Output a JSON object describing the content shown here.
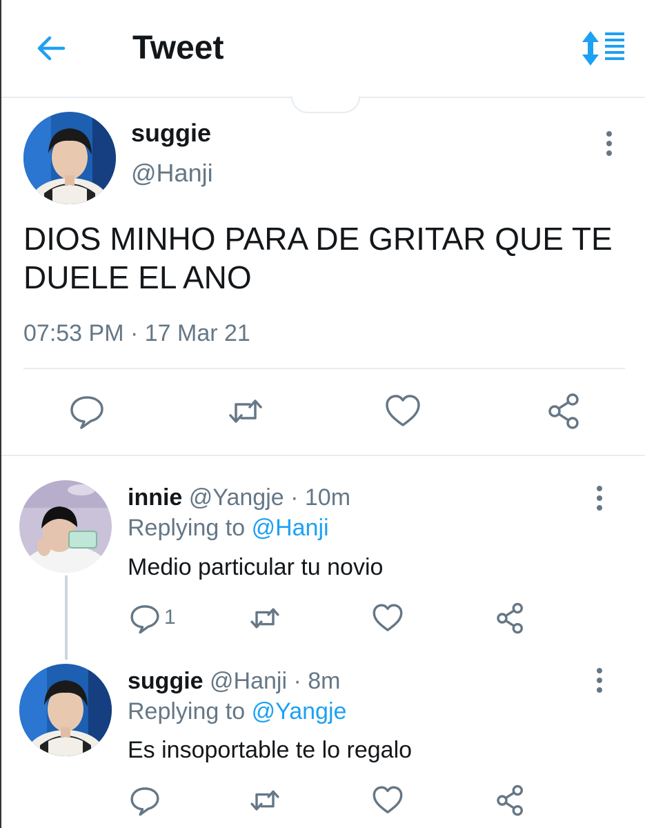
{
  "header": {
    "title": "Tweet",
    "accent_color": "#1da1f2",
    "back_icon": "arrow-left-icon",
    "sort_icon": "sort-list-icon"
  },
  "tweet": {
    "name": "suggie",
    "handle": "@Hanji",
    "text": "DIOS MINHO PARA DE GRITAR QUE TE DUELE EL ANO",
    "timestamp": "07:53 PM · 17 Mar 21"
  },
  "replies": [
    {
      "name": "innie",
      "handle": "@Yangje",
      "separator": "·",
      "time": "10m",
      "replying_prefix": "Replying to",
      "replying_to": "@Hanji",
      "text": "Medio particular tu novio",
      "reply_count": "1"
    },
    {
      "name": "suggie",
      "handle": "@Hanji",
      "separator": "·",
      "time": "8m",
      "replying_prefix": "Replying to",
      "replying_to": "@Yangje",
      "text": "Es insoportable te lo regalo",
      "reply_count": ""
    }
  ],
  "icons": [
    "reply-icon",
    "retweet-icon",
    "like-icon",
    "share-icon",
    "more-vertical-icon"
  ]
}
